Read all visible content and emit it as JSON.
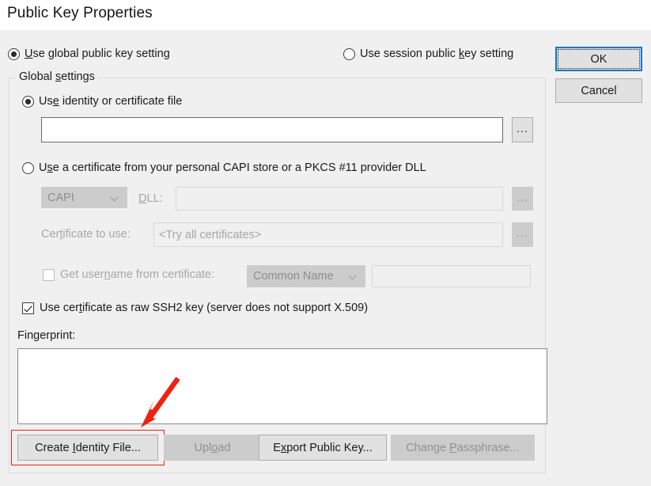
{
  "window": {
    "title": "Public Key Properties"
  },
  "colors": {
    "dialog_bg": "#f0f0f0",
    "accent_focus": "#0078d7",
    "annotation_red": "#ee2211",
    "button_face": "#e1e1e1",
    "disabled_text": "#919191"
  },
  "scope": {
    "global_radio": {
      "label_pre": "U",
      "label_key": "s",
      "label_post": "e global public key setting",
      "checked": true
    },
    "session_radio": {
      "label_pre": "Use session public ",
      "label_key": "k",
      "label_post": "ey setting",
      "checked": false
    }
  },
  "dialog_buttons": {
    "ok": "OK",
    "cancel": "Cancel"
  },
  "group": {
    "title_pre": "Global ",
    "title_key": "s",
    "title_post": "ettings"
  },
  "identity": {
    "radio": {
      "pre": "Us",
      "key": "e",
      "post": " identity or certificate file",
      "checked": true
    },
    "file_value": "",
    "file_placeholder": "",
    "browse_label": "...",
    "browse_enabled": true
  },
  "capi": {
    "radio": {
      "pre": "U",
      "key": "s",
      "post": "e a certificate from your personal CAPI store or a PKCS #11 provider DLL",
      "checked": false
    },
    "provider_value": "CAPI",
    "provider_options": [
      "CAPI"
    ],
    "dll_label_pre": "D",
    "dll_label_key": "L",
    "dll_label_post": "L:",
    "dll_value": "",
    "dll_browse_label": "...",
    "cert_label_pre": "Cer",
    "cert_label_key": "t",
    "cert_label_post": "ificate to use:",
    "cert_value": "<Try all certificates>",
    "cert_browse_label": "...",
    "username_checkbox": {
      "pre": "Get user",
      "key": "n",
      "post": "ame from certificate:",
      "checked": false
    },
    "username_source_value": "Common Name",
    "username_source_options": [
      "Common Name"
    ],
    "username_value": ""
  },
  "raw_ssh2": {
    "pre": "Use cer",
    "key": "t",
    "post": "ificate as raw SSH2 key (server does not support X.509)",
    "checked": true
  },
  "fingerprint": {
    "label": "Fingerprint:",
    "value": ""
  },
  "action_buttons": {
    "create_identity": {
      "pre": "Create ",
      "key": "I",
      "post": "dentity File...",
      "enabled": true,
      "highlighted": true
    },
    "upload": {
      "pre": "Upl",
      "key": "o",
      "post": "ad",
      "enabled": false
    },
    "export_public_key": {
      "pre": "E",
      "key": "x",
      "post": "port Public Key...",
      "enabled": true
    },
    "change_passphrase": {
      "pre": "Change ",
      "key": "P",
      "post": "assphrase...",
      "enabled": false
    }
  },
  "annotation": {
    "arrow": "red-arrow pointing down-left to Create Identity File button"
  }
}
